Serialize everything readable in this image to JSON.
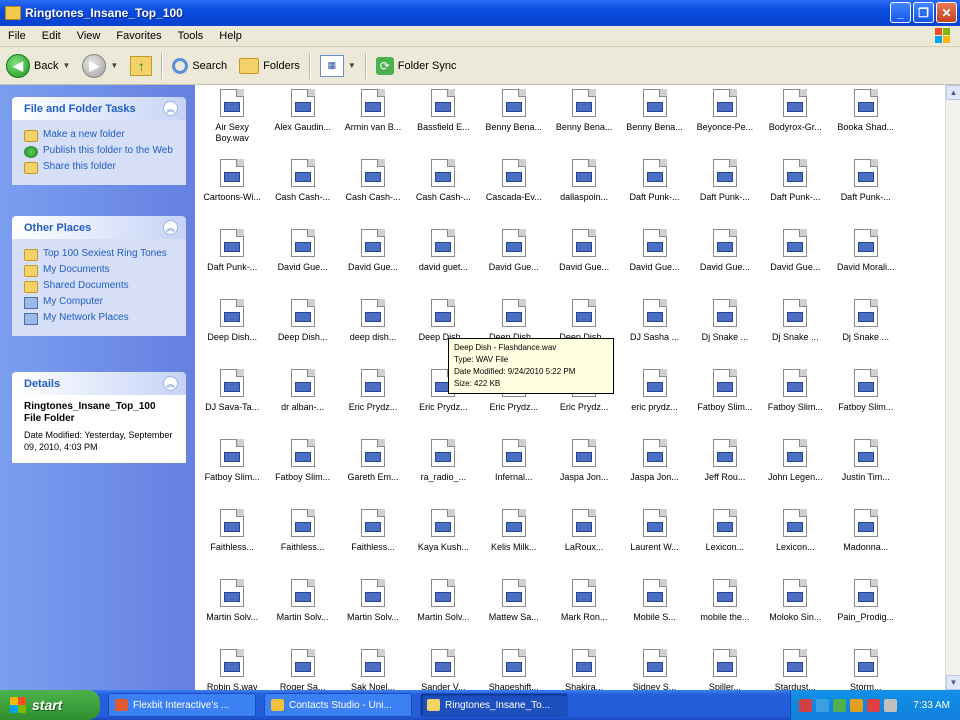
{
  "window": {
    "title": "Ringtones_Insane_Top_100",
    "controls": [
      "_",
      "❐",
      "✕"
    ]
  },
  "menu": [
    "File",
    "Edit",
    "View",
    "Favorites",
    "Tools",
    "Help"
  ],
  "toolbar": {
    "back": "Back",
    "search": "Search",
    "folders": "Folders",
    "folder_sync": "Folder Sync"
  },
  "left_pane": {
    "tasks": {
      "title": "File and Folder Tasks",
      "items": [
        "Make a new folder",
        "Publish this folder to the Web",
        "Share this folder"
      ]
    },
    "places": {
      "title": "Other Places",
      "items": [
        "Top 100 Sexiest Ring Tones",
        "My Documents",
        "Shared Documents",
        "My Computer",
        "My Network Places"
      ]
    },
    "details": {
      "title": "Details",
      "name": "Ringtones_Insane_Top_100",
      "type": "File Folder",
      "modified": "Date Modified: Yesterday, September 09, 2010, 4:03 PM"
    }
  },
  "files": [
    "Air Sexy Boy.wav",
    "Alex Gaudin...",
    "Armin van B...",
    "Bassfield E...",
    "Benny Bena...",
    "Benny Bena...",
    "Benny Bena...",
    "Beyonce-Pe...",
    "Bodyrox-Gr...",
    "Booka Shad...",
    "Cartoons-Wi...",
    "Cash Cash-...",
    "Cash Cash-...",
    "Cash Cash-...",
    "Cascada-Ev...",
    "dallaspoin...",
    "Daft Punk-...",
    "Daft Punk-...",
    "Daft Punk-...",
    "Daft Punk-...",
    "Daft Punk-...",
    "David Gue...",
    "David Gue...",
    "david guet...",
    "David Gue...",
    "David Gue...",
    "David Gue...",
    "David Gue...",
    "David Gue...",
    "David Morali...",
    "Deep Dish...",
    "Deep Dish...",
    "deep dish...",
    "Deep Dish...",
    "Deep Dish...",
    "Deep Dish...",
    "DJ Sasha ...",
    "Dj Snake ...",
    "Dj Snake ...",
    "Dj Snake ...",
    "DJ Sava-Ta...",
    "dr alban-...",
    "Eric Prydz...",
    "Eric Prydz...",
    "Eric Prydz...",
    "Eric Prydz...",
    "eric prydz...",
    "Fatboy Slim...",
    "Fatboy Slim...",
    "Fatboy Slim...",
    "Fatboy Slim...",
    "Fatboy Slim...",
    "Gareth Em...",
    "ra_radio_...",
    "Infernal...",
    "Jaspa Jon...",
    "Jaspa Jon...",
    "Jeff Rou...",
    "John Legen...",
    "Justin Tim...",
    "Faithless...",
    "Faithless...",
    "Faithless...",
    "Kaya Kush...",
    "Kelis Milk...",
    "LaRoux...",
    "Laurent W...",
    "Lexicon...",
    "Lexicon...",
    "Madonna...",
    "Martin Solv...",
    "Martin Solv...",
    "Martin Solv...",
    "Martin Solv...",
    "Mattew Sa...",
    "Mark Ron...",
    "Mobile S...",
    "mobile the...",
    "Moloko Sin...",
    "Pain_Prodig...",
    "Robin S.wav",
    "Roger Sa...",
    "Sak Noel...",
    "Sander V...",
    "Shapeshift...",
    "Shakira...",
    "Sidney S...",
    "Spiller...",
    "Stardust...",
    "Storm..."
  ],
  "tooltip": {
    "lines": [
      "Deep Dish - Flashdance.wav",
      "Type: WAV File",
      "Date Modified: 9/24/2010 5:22 PM",
      "Size: 422 KB"
    ]
  },
  "taskbar": {
    "start": "start",
    "tasks": [
      "Flexbit Interactive's ...",
      "Contacts Studio - Uni...",
      "Ringtones_Insane_To..."
    ],
    "clock": "7:33 AM"
  },
  "colors": {
    "title_blue": "#0a4be0",
    "left_pane": "#6f8fe8",
    "tooltip_bg": "#ffffe1",
    "start_green": "#2f8f2f"
  }
}
